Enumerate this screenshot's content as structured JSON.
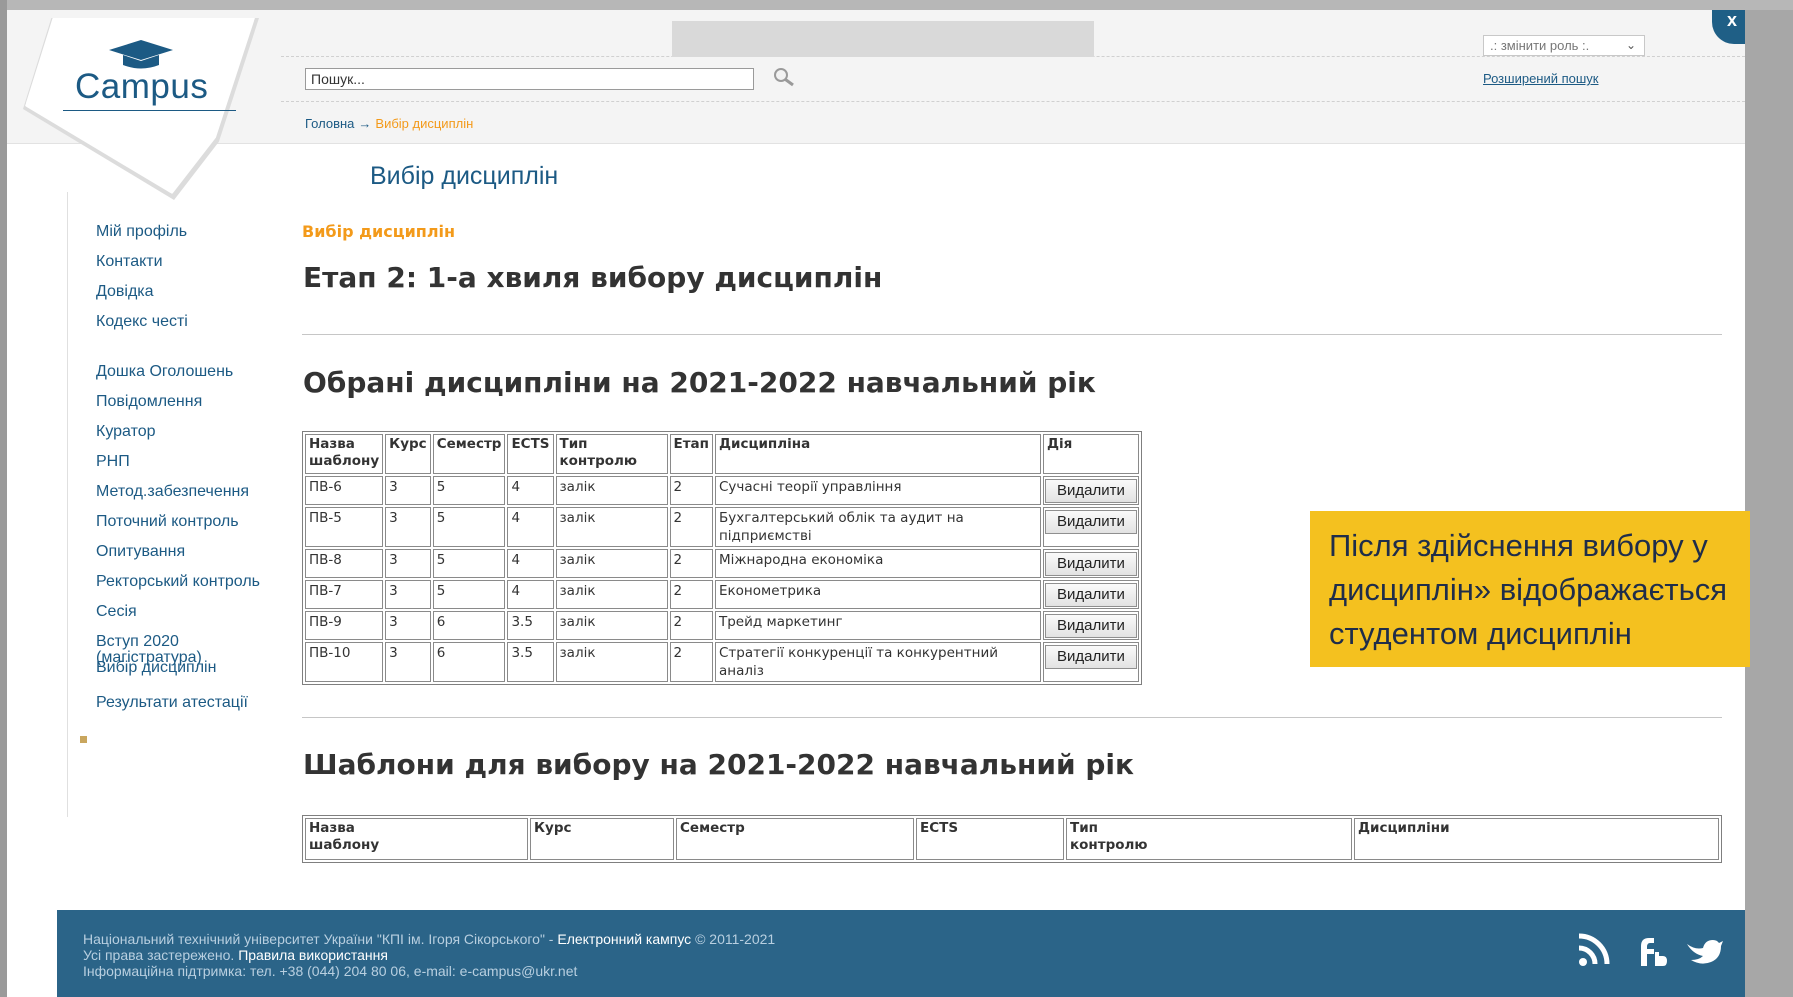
{
  "logo": {
    "text": "Campus"
  },
  "header": {
    "search_placeholder": "Пошук...",
    "role_select": ".: змінити роль :.",
    "advanced_search": "Розширений пошук",
    "close_label": "x"
  },
  "breadcrumb": {
    "home": "Головна",
    "separator": "→",
    "current": "Вибір дисциплін"
  },
  "page_title": "Вибір дисциплін",
  "sidebar": {
    "group1": [
      "Мій профіль",
      "Контакти",
      "Довідка",
      "Кодекс честі"
    ],
    "group2": [
      "Дошка Оголошень",
      "Повідомлення",
      "Куратор",
      "РНП",
      "Метод.забезпечення",
      "Поточний контроль",
      "Опитування",
      "Ректорський контроль",
      "Сесія"
    ],
    "admission_line1": "Вступ 2020",
    "admission_line2": "(магістратура)",
    "active_item": "Вибір дисциплін",
    "last_item": "Результати атестації"
  },
  "content": {
    "section_label": "Вибір дисциплін",
    "stage_heading": "Етап 2: 1-а хвиля вибору дисциплін",
    "chosen_heading": "Обрані дисципліни на 2021-2022 навчальний рік",
    "templates_heading": "Шаблони для вибору на 2021-2022 навчальний рік"
  },
  "chosen_table": {
    "headers": {
      "template_l1": "Назва",
      "template_l2": "шаблону",
      "course": "Курс",
      "semester": "Семестр",
      "ects": "ECTS",
      "control": "Тип контролю",
      "stage": "Етап",
      "discipline": "Дисципліна",
      "action": "Дія"
    },
    "rows": [
      {
        "template": "ПВ-6",
        "course": "3",
        "semester": "5",
        "ects": "4",
        "control": "залік",
        "stage": "2",
        "discipline": "Сучасні теорії управління",
        "action": "Видалити"
      },
      {
        "template": "ПВ-5",
        "course": "3",
        "semester": "5",
        "ects": "4",
        "control": "залік",
        "stage": "2",
        "discipline": "Бухгалтерський облік та аудит на підприємстві",
        "action": "Видалити"
      },
      {
        "template": "ПВ-8",
        "course": "3",
        "semester": "5",
        "ects": "4",
        "control": "залік",
        "stage": "2",
        "discipline": "Міжнародна економіка",
        "action": "Видалити"
      },
      {
        "template": "ПВ-7",
        "course": "3",
        "semester": "5",
        "ects": "4",
        "control": "залік",
        "stage": "2",
        "discipline": "Економетрика",
        "action": "Видалити"
      },
      {
        "template": "ПВ-9",
        "course": "3",
        "semester": "6",
        "ects": "3.5",
        "control": "залік",
        "stage": "2",
        "discipline": "Трейд маркетинг",
        "action": "Видалити"
      },
      {
        "template": "ПВ-10",
        "course": "3",
        "semester": "6",
        "ects": "3.5",
        "control": "залік",
        "stage": "2",
        "discipline": "Стратегії конкуренції та конкурентний аналіз",
        "action": "Видалити"
      }
    ]
  },
  "templates_table": {
    "template_l1": "Назва",
    "template_l2": "шаблону",
    "course": "Курс",
    "semester": "Семестр",
    "ects": "ECTS",
    "control_l1": "Тип",
    "control_l2": "контролю",
    "disciplines": "Дисципліни"
  },
  "callout": {
    "line1": "Після здійснення вибору у",
    "line2": "дисциплін» відображається",
    "line3": "студентом дисциплін"
  },
  "footer": {
    "line1_prefix": "Національний технічний університет України \"КПІ ім. Ігоря Сікорського\" - ",
    "line1_link": "Електронний кампус",
    "line1_suffix": " © 2011-2021",
    "line2_prefix": "Усі права застережено. ",
    "line2_link": "Правила використання",
    "line3": "Інформаційна підтримка: тел. +38 (044) 204 80 06, e-mail: e-campus@ukr.net"
  },
  "icons": [
    "graduation-cap-icon",
    "search-icon",
    "rss-icon",
    "facebook-icon",
    "twitter-icon"
  ]
}
